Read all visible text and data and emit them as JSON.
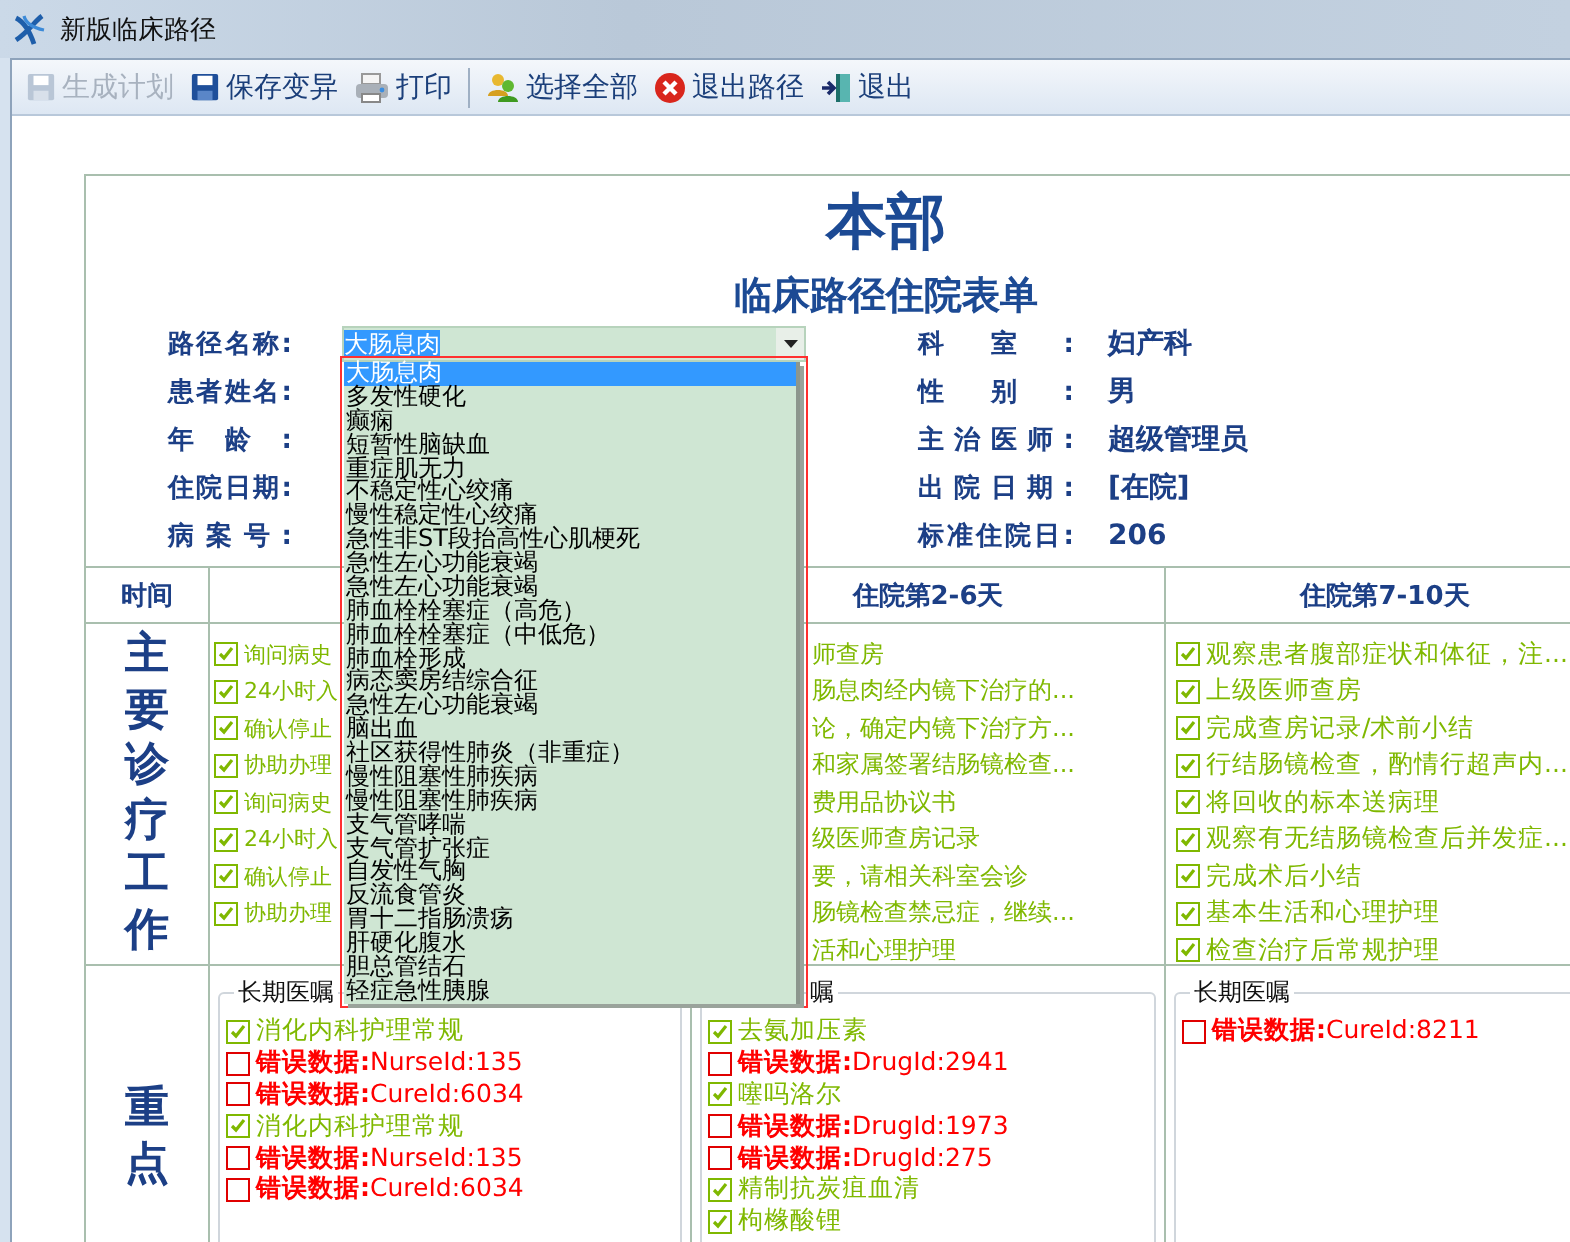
{
  "window": {
    "title": "新版临床路径"
  },
  "toolbar": [
    [
      {
        "label": "生成计划",
        "disabled": true
      },
      {
        "label": "保存变异",
        "disabled": false
      },
      {
        "label": "打印",
        "disabled": false
      }
    ],
    [
      {
        "label": "选择全部",
        "disabled": false
      },
      {
        "label": "退出路径",
        "disabled": false
      },
      {
        "label": "退出",
        "disabled": false
      }
    ]
  ],
  "form": {
    "hospital": "本部",
    "title": "临床路径住院表单",
    "left_fields": [
      {
        "label": "路径名称:",
        "kind": "combo",
        "value": "大肠息肉"
      },
      {
        "label": "患者姓名:",
        "kind": "text"
      },
      {
        "label": "年龄:",
        "kind": "text"
      },
      {
        "label": "住院日期:",
        "kind": "text"
      },
      {
        "label": "病案号:",
        "kind": "text"
      }
    ],
    "right_fields": [
      {
        "label": "科室:",
        "value": "妇产科"
      },
      {
        "label": "性别:",
        "value": "男"
      },
      {
        "label": "主治医师:",
        "value": "超级管理员"
      },
      {
        "label": "出院日期:",
        "value": "[在院]"
      },
      {
        "label": "标准住院日:",
        "value": "206"
      }
    ],
    "path_options": [
      {
        "text": "大肠息肉",
        "selected": true
      },
      {
        "text": "多发性硬化",
        "selected": false
      },
      {
        "text": "癫痫",
        "selected": false
      },
      {
        "text": "短暂性脑缺血",
        "selected": false
      },
      {
        "text": "重症肌无力",
        "selected": false
      },
      {
        "text": "不稳定性心绞痛",
        "selected": false
      },
      {
        "text": "慢性稳定性心绞痛",
        "selected": false
      },
      {
        "text": "急性非ST段抬高性心肌梗死",
        "selected": false
      },
      {
        "text": "急性左心功能衰竭",
        "selected": false
      },
      {
        "text": "急性左心功能衰竭",
        "selected": false
      },
      {
        "text": "肺血栓栓塞症（高危）",
        "selected": false
      },
      {
        "text": "肺血栓栓塞症（中低危）",
        "selected": false
      },
      {
        "text": "肺血栓形成",
        "selected": false
      },
      {
        "text": "病态窦房结综合征",
        "selected": false
      },
      {
        "text": "急性左心功能衰竭",
        "selected": false
      },
      {
        "text": "脑出血",
        "selected": false
      },
      {
        "text": "社区获得性肺炎（非重症）",
        "selected": false
      },
      {
        "text": "慢性阻塞性肺疾病",
        "selected": false
      },
      {
        "text": "慢性阻塞性肺疾病",
        "selected": false
      },
      {
        "text": "支气管哮喘",
        "selected": false
      },
      {
        "text": "支气管扩张症",
        "selected": false
      },
      {
        "text": "自发性气胸",
        "selected": false
      },
      {
        "text": "反流食管炎",
        "selected": false
      },
      {
        "text": "胃十二指肠溃疡",
        "selected": false
      },
      {
        "text": "肝硬化腹水",
        "selected": false
      },
      {
        "text": "胆总管结石",
        "selected": false
      },
      {
        "text": "轻症急性胰腺",
        "selected": false
      }
    ]
  },
  "table": {
    "time_header": "时间",
    "day_headers": [
      "住院第2-6天",
      "住院第7-10天"
    ],
    "rows": [
      {
        "title": "主要诊疗工作",
        "cells": [
          {
            "items": [
              {
                "text": "询问病史",
                "checked": true
              },
              {
                "text": "24小时入",
                "checked": true
              },
              {
                "text": "确认停止",
                "checked": true
              },
              {
                "text": "协助办理",
                "checked": true
              },
              {
                "text": "询问病史",
                "checked": true
              },
              {
                "text": "24小时入",
                "checked": true
              },
              {
                "text": "确认停止",
                "checked": true
              },
              {
                "text": "协助办理",
                "checked": true
              }
            ]
          },
          {
            "items": [
              {
                "text": "师查房"
              },
              {
                "text": "肠息肉经内镜下治疗的..."
              },
              {
                "text": "论，确定内镜下治疗方..."
              },
              {
                "text": "和家属签署结肠镜检查..."
              },
              {
                "text": "费用品协议书"
              },
              {
                "text": "级医师查房记录"
              },
              {
                "text": "要，请相关科室会诊"
              },
              {
                "text": "肠镜检查禁忌症，继续..."
              },
              {
                "text": "活和心理护理"
              }
            ]
          },
          {
            "items": [
              {
                "text": "观察患者腹部症状和体征，注...",
                "checked": true
              },
              {
                "text": "上级医师查房",
                "checked": true
              },
              {
                "text": "完成查房记录/术前小结",
                "checked": true
              },
              {
                "text": "行结肠镜检查，酌情行超声内...",
                "checked": true
              },
              {
                "text": "将回收的标本送病理",
                "checked": true
              },
              {
                "text": "观察有无结肠镜检查后并发症...",
                "checked": true
              },
              {
                "text": "完成术后小结",
                "checked": true
              },
              {
                "text": "基本生活和心理护理",
                "checked": true
              },
              {
                "text": "检查治疗后常规护理",
                "checked": true
              }
            ]
          }
        ]
      },
      {
        "title": "重点",
        "cells": [
          {
            "group": "长期医嘱",
            "items": [
              {
                "text": "消化内科护理常规",
                "checked": true
              },
              {
                "text": "**错误数据:**NurseId:135",
                "checked": false
              },
              {
                "text": "**错误数据:**CureId:6034",
                "checked": false
              },
              {
                "text": "消化内科护理常规",
                "checked": true
              },
              {
                "text": "**错误数据:**NurseId:135",
                "checked": false
              },
              {
                "text": "**错误数据:**CureId:6034",
                "checked": false
              }
            ]
          },
          {
            "group": "嘱",
            "items": [
              {
                "text": "去氨加压素",
                "checked": true
              },
              {
                "text": "**错误数据:**DrugId:2941",
                "checked": false
              },
              {
                "text": "噻吗洛尔",
                "checked": true
              },
              {
                "text": "**错误数据:**DrugId:1973",
                "checked": false
              },
              {
                "text": "**错误数据:**DrugId:275",
                "checked": false
              },
              {
                "text": "精制抗炭疽血清",
                "checked": true
              },
              {
                "text": "枸橼酸锂",
                "checked": true
              }
            ]
          },
          {
            "group": "长期医嘱",
            "items": [
              {
                "text": "**错误数据:**CureId:8211",
                "checked": false
              }
            ]
          }
        ]
      }
    ]
  }
}
